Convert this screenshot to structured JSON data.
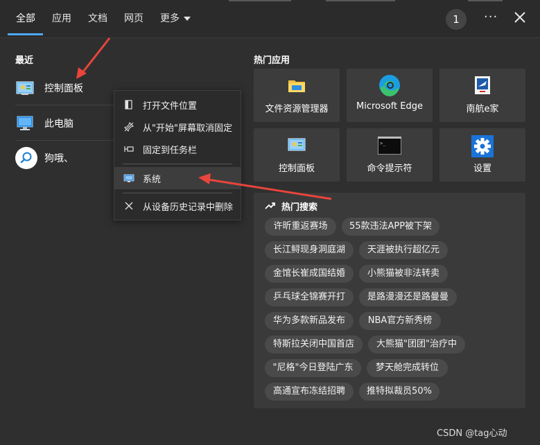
{
  "tabs": [
    {
      "label": "全部"
    },
    {
      "label": "应用"
    },
    {
      "label": "文档"
    },
    {
      "label": "网页"
    },
    {
      "label": "更多"
    }
  ],
  "header": {
    "badge_count": "1",
    "more_glyph": "···"
  },
  "recent": {
    "title": "最近",
    "items": [
      {
        "label": "控制面板",
        "icon": "control-panel-icon"
      },
      {
        "label": "此电脑",
        "icon": "computer-icon"
      },
      {
        "label": "狗哦、",
        "icon": "search-icon"
      }
    ]
  },
  "context_menu": {
    "items": [
      {
        "label": "打开文件位置",
        "icon": "open-folder-icon"
      },
      {
        "label": "从\"开始\"屏幕取消固定",
        "icon": "unpin-icon"
      },
      {
        "label": "固定到任务栏",
        "icon": "pin-icon"
      },
      {
        "label": "系统",
        "icon": "system-icon"
      },
      {
        "label": "从设备历史记录中删除",
        "icon": "close-icon"
      }
    ]
  },
  "hot_apps": {
    "title": "热门应用",
    "items": [
      {
        "label": "文件资源管理器",
        "icon": "file-explorer-icon"
      },
      {
        "label": "Microsoft Edge",
        "icon": "edge-icon"
      },
      {
        "label": "南航e家",
        "icon": "app-icon"
      },
      {
        "label": "控制面板",
        "icon": "control-panel-icon"
      },
      {
        "label": "命令提示符",
        "icon": "terminal-icon"
      },
      {
        "label": "设置",
        "icon": "gear-icon"
      }
    ]
  },
  "hot_search": {
    "title": "热门搜索",
    "chips": [
      "许昕重返赛场",
      "55款违法APP被下架",
      "长江鲟现身洞庭湖",
      "天涯被执行超亿元",
      "金馆长崔成国结婚",
      "小熊猫被非法转卖",
      "乒乓球全锦赛开打",
      "是路漫漫还是路曼曼",
      "华为多款新品发布",
      "NBA官方新秀榜",
      "特斯拉关闭中国首店",
      "大熊猫\"团团\"治疗中",
      "\"尼格\"今日登陆广东",
      "梦天舱完成转位",
      "高通宣布冻结招聘",
      "推特拟裁员50%"
    ]
  },
  "watermark": "CSDN @tag心动",
  "colors": {
    "accent": "#4ea8ff",
    "arrow": "#e8453c",
    "background": "#2f2f2f"
  }
}
